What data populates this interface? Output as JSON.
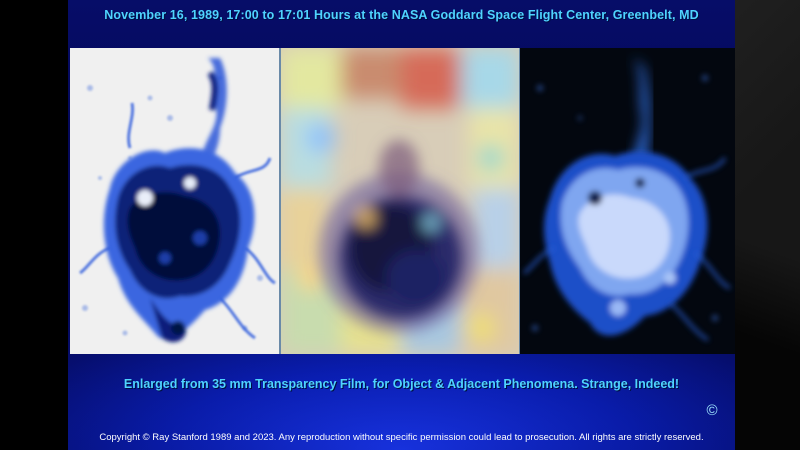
{
  "slide": {
    "title": "November 16, 1989, 17:00 to 17:01 Hours at the NASA Goddard Space Flight Center, Greenbelt, MD",
    "caption": "Enlarged from 35 mm Transparency Film, for Object & Adjacent Phenomena. Strange, Indeed!",
    "copyright_symbol": "©",
    "footer": "Copyright © Ray Stanford 1989 and 2023.  Any reproduction without specific permission could lead to prosecution. All rights are strictly reserved."
  },
  "colors": {
    "background": "#0a1fb8",
    "title_text": "#4fd3ff",
    "footer_text": "#ffffff"
  },
  "images": [
    {
      "name": "inverted-blue-enhancement"
    },
    {
      "name": "color-enhancement"
    },
    {
      "name": "blue-glow-enhancement"
    }
  ]
}
